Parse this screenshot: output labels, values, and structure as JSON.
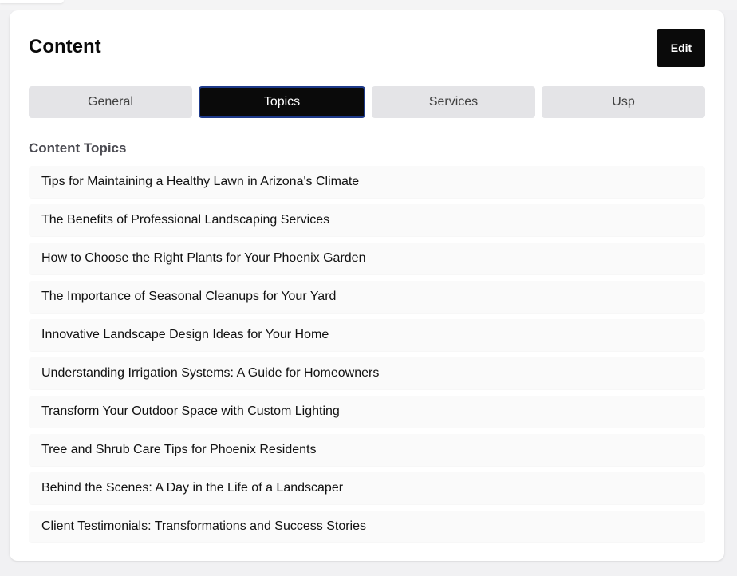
{
  "header": {
    "title": "Content",
    "edit_label": "Edit"
  },
  "tabs": [
    {
      "label": "General",
      "active": false
    },
    {
      "label": "Topics",
      "active": true
    },
    {
      "label": "Services",
      "active": false
    },
    {
      "label": "Usp",
      "active": false
    }
  ],
  "section": {
    "label": "Content Topics"
  },
  "topics": [
    "Tips for Maintaining a Healthy Lawn in Arizona's Climate",
    "The Benefits of Professional Landscaping Services",
    "How to Choose the Right Plants for Your Phoenix Garden",
    "The Importance of Seasonal Cleanups for Your Yard",
    "Innovative Landscape Design Ideas for Your Home",
    "Understanding Irrigation Systems: A Guide for Homeowners",
    "Transform Your Outdoor Space with Custom Lighting",
    "Tree and Shrub Care Tips for Phoenix Residents",
    "Behind the Scenes: A Day in the Life of a Landscaper",
    "Client Testimonials: Transformations and Success Stories"
  ],
  "colors": {
    "primary": "#0a0a0a",
    "tab_inactive_bg": "#e4e4e7",
    "active_tab_border": "#1e3a8a",
    "row_bg": "#fafafa"
  }
}
